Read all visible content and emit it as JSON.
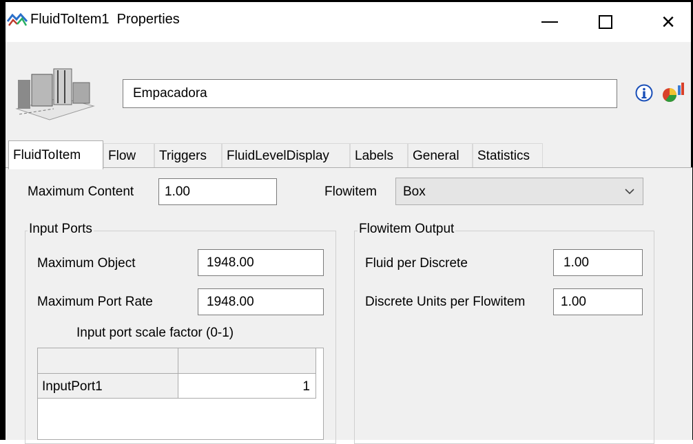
{
  "window": {
    "title": "FluidToItem1  Properties",
    "controls": {
      "minimize": "minimize",
      "maximize": "maximize",
      "close": "×"
    }
  },
  "header": {
    "name_value": "Empacadora",
    "icons": [
      "object-thumbnail-icon",
      "info-icon",
      "statistics-icon"
    ]
  },
  "tabs": [
    {
      "label": "FluidToItem",
      "active": true
    },
    {
      "label": "Flow"
    },
    {
      "label": "Triggers"
    },
    {
      "label": "FluidLevelDisplay"
    },
    {
      "label": "Labels"
    },
    {
      "label": "General"
    },
    {
      "label": "Statistics"
    }
  ],
  "fluidtoitem": {
    "max_content_label": "Maximum Content",
    "max_content_value": "1.00",
    "flowitem_label": "Flowitem",
    "flowitem_value": "Box",
    "input_ports": {
      "title": "Input Ports",
      "max_object_label": "Maximum Object",
      "max_object_value": "1948.00",
      "max_port_rate_label": "Maximum Port Rate",
      "max_port_rate_value": "1948.00",
      "scale_factor_label": "Input port scale factor (0-1)",
      "table": {
        "columns": [
          "",
          ""
        ],
        "rows": [
          {
            "name": "InputPort1",
            "value": "1"
          }
        ]
      }
    },
    "flowitem_output": {
      "title": "Flowitem Output",
      "fluid_per_discrete_label": "Fluid per Discrete",
      "fluid_per_discrete_value": "1.00",
      "units_per_flowitem_label": "Discrete Units per Flowitem",
      "units_per_flowitem_value": "1.00"
    }
  },
  "colors": {
    "panel_bg": "#f0f0f0",
    "border": "#7a7a7a",
    "info_blue": "#1a4fb8"
  }
}
